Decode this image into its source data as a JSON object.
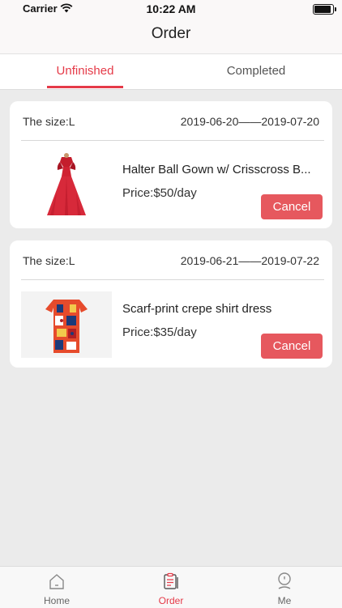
{
  "status_bar": {
    "carrier": "Carrier",
    "time": "10:22 AM"
  },
  "header": {
    "title": "Order"
  },
  "tabs": [
    {
      "label": "Unfinished",
      "active": true
    },
    {
      "label": "Completed",
      "active": false
    }
  ],
  "orders": [
    {
      "size": "The size:L",
      "dates": "2019-06-20——2019-07-20",
      "product_name": "Halter Ball Gown w/ Crisscross B...",
      "price": "Price:$50/day",
      "action": "Cancel"
    },
    {
      "size": "The size:L",
      "dates": "2019-06-21——2019-07-22",
      "product_name": "Scarf-print crepe shirt dress",
      "price": "Price:$35/day",
      "action": "Cancel"
    }
  ],
  "tabbar": [
    {
      "label": "Home",
      "icon": "home-icon"
    },
    {
      "label": "Order",
      "icon": "order-icon",
      "active": true
    },
    {
      "label": "Me",
      "icon": "profile-icon"
    }
  ],
  "colors": {
    "accent": "#e53a48",
    "cancel_button": "#e6585e",
    "background": "#ebebeb"
  }
}
